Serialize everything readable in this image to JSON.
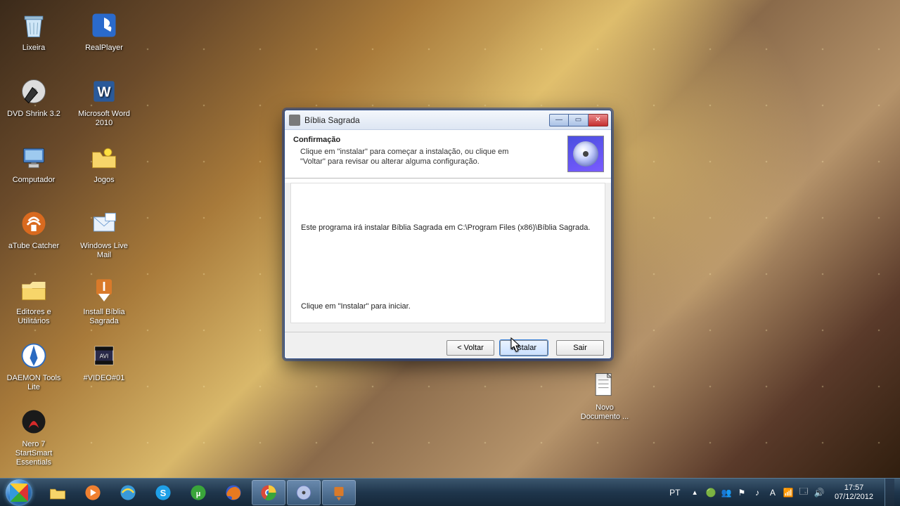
{
  "desktop": {
    "icons_col1": [
      {
        "name": "lixeira",
        "label": "Lixeira"
      },
      {
        "name": "dvd-shrink",
        "label": "DVD Shrink 3.2"
      },
      {
        "name": "computador",
        "label": "Computador"
      },
      {
        "name": "atube-catcher",
        "label": "aTube Catcher"
      },
      {
        "name": "editores-utilitarios",
        "label": "Editores e Utilitários"
      },
      {
        "name": "daemon-tools",
        "label": "DAEMON Tools Lite"
      },
      {
        "name": "nero",
        "label": "Nero 7 StartSmart Essentials"
      }
    ],
    "icons_col2": [
      {
        "name": "realplayer",
        "label": "RealPlayer"
      },
      {
        "name": "word-2010",
        "label": "Microsoft Word 2010"
      },
      {
        "name": "jogos",
        "label": "Jogos"
      },
      {
        "name": "windows-live-mail",
        "label": "Windows Live Mail"
      },
      {
        "name": "install-biblia",
        "label": "Install Bíblia Sagrada"
      },
      {
        "name": "video01",
        "label": "#VIDEO#01"
      }
    ],
    "extra_icon": {
      "name": "novo-documento",
      "label": "Novo Documento ..."
    }
  },
  "dialog": {
    "title": "Bíblia Sagrada",
    "heading": "Confirmação",
    "subheading": "Clique em \"instalar\" para começar a instalação, ou clique em \"Voltar\" para revisar ou alterar alguma configuração.",
    "body_line1": "Este programa irá instalar Bíblia Sagrada em C:\\Program Files (x86)\\Bíblia Sagrada.",
    "body_line2": "Clique em \"Instalar\" para iniciar.",
    "buttons": {
      "back": "< Voltar",
      "install": "Instalar",
      "exit": "Sair"
    }
  },
  "taskbar": {
    "pinned": [
      {
        "name": "explorer",
        "active": false
      },
      {
        "name": "wmplayer",
        "active": false
      },
      {
        "name": "ie",
        "active": false
      },
      {
        "name": "skype",
        "active": false
      },
      {
        "name": "utorrent",
        "active": false
      },
      {
        "name": "firefox",
        "active": false
      },
      {
        "name": "chrome",
        "active": true
      },
      {
        "name": "disc",
        "active": true
      },
      {
        "name": "installer",
        "active": true
      }
    ],
    "lang": "PT",
    "tray_icons": [
      "safe-remove",
      "network",
      "flag",
      "audio",
      "a",
      "wifi",
      "battery",
      "volume"
    ],
    "clock": {
      "time": "17:57",
      "date": "07/12/2012"
    }
  }
}
